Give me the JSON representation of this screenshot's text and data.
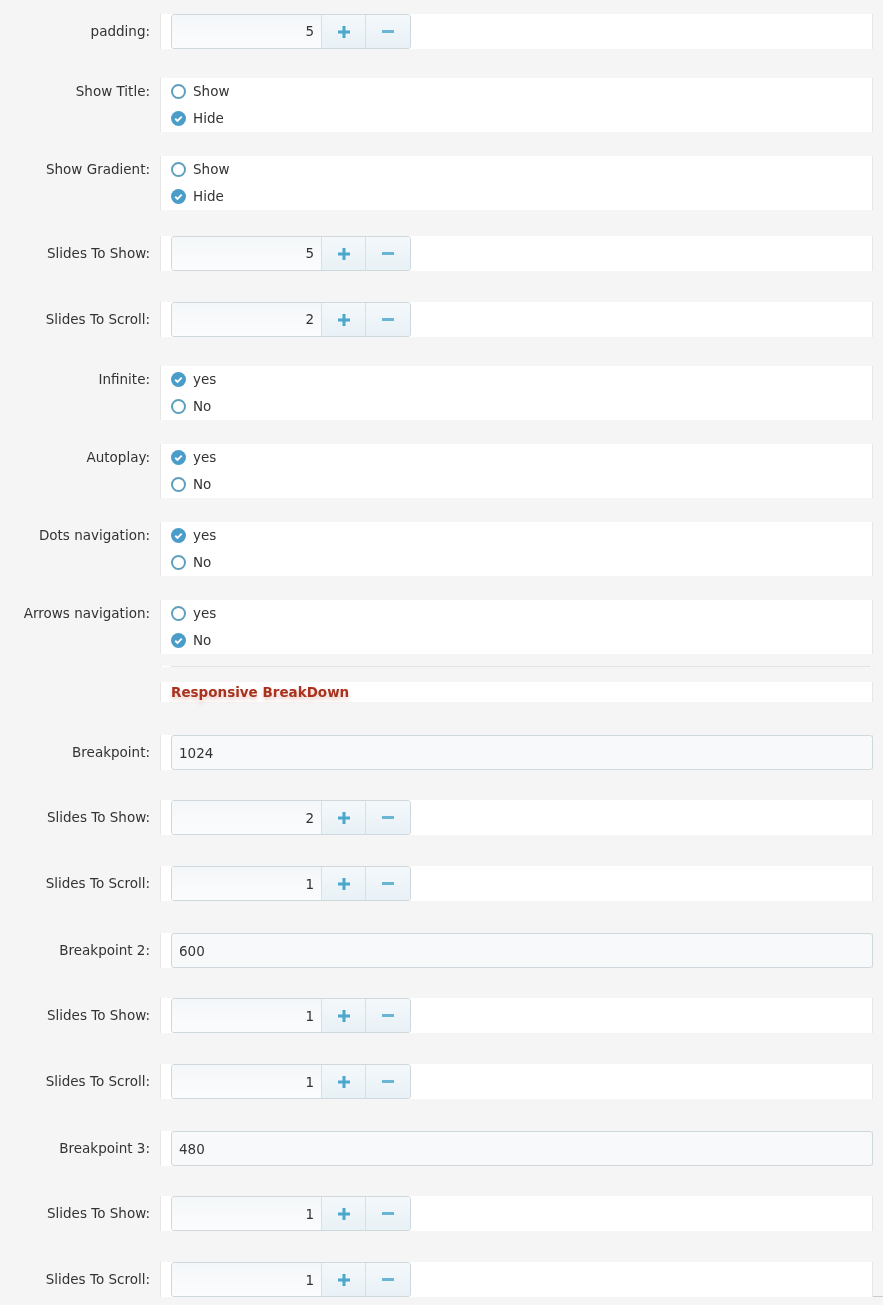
{
  "rows": [
    {
      "kind": "spinner",
      "label": "padding:",
      "value": "5"
    },
    {
      "kind": "radio",
      "label": "Show Title:",
      "options": [
        {
          "label": "Show",
          "selected": false
        },
        {
          "label": "Hide",
          "selected": true
        }
      ]
    },
    {
      "kind": "radio",
      "label": "Show Gradient:",
      "options": [
        {
          "label": "Show",
          "selected": false
        },
        {
          "label": "Hide",
          "selected": true
        }
      ]
    },
    {
      "kind": "spinner",
      "label": "Slides To Show:",
      "value": "5"
    },
    {
      "kind": "spinner",
      "label": "Slides To Scroll:",
      "value": "2"
    },
    {
      "kind": "radio",
      "label": "Infinite:",
      "options": [
        {
          "label": "yes",
          "selected": true
        },
        {
          "label": "No",
          "selected": false
        }
      ]
    },
    {
      "kind": "radio",
      "label": "Autoplay:",
      "options": [
        {
          "label": "yes",
          "selected": true
        },
        {
          "label": "No",
          "selected": false
        }
      ]
    },
    {
      "kind": "radio",
      "label": "Dots navigation:",
      "options": [
        {
          "label": "yes",
          "selected": true
        },
        {
          "label": "No",
          "selected": false
        }
      ]
    },
    {
      "kind": "radio",
      "label": "Arrows navigation:",
      "options": [
        {
          "label": "yes",
          "selected": false
        },
        {
          "label": "No",
          "selected": true
        }
      ]
    },
    {
      "kind": "divider"
    },
    {
      "kind": "heading",
      "text": "Responsive BreakDown"
    },
    {
      "kind": "text",
      "label": "Breakpoint:",
      "value": "1024"
    },
    {
      "kind": "spinner",
      "label": "Slides To Show:",
      "value": "2"
    },
    {
      "kind": "spinner",
      "label": "Slides To Scroll:",
      "value": "1"
    },
    {
      "kind": "text",
      "label": "Breakpoint 2:",
      "value": "600"
    },
    {
      "kind": "spinner",
      "label": "Slides To Show:",
      "value": "1"
    },
    {
      "kind": "spinner",
      "label": "Slides To Scroll:",
      "value": "1"
    },
    {
      "kind": "text",
      "label": "Breakpoint 3:",
      "value": "480"
    },
    {
      "kind": "spinner",
      "label": "Slides To Show:",
      "value": "1"
    },
    {
      "kind": "spinner",
      "label": "Slides To Scroll:",
      "value": "1"
    }
  ]
}
